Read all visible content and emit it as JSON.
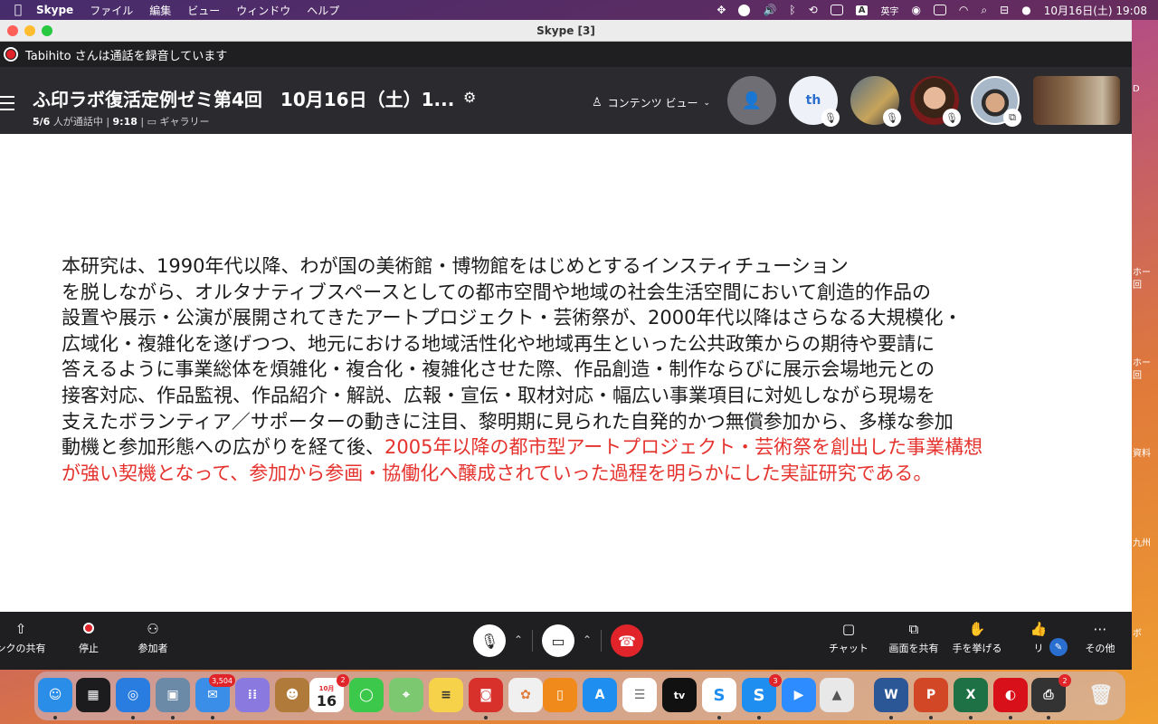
{
  "menubar": {
    "app": "Skype",
    "items": [
      "ファイル",
      "編集",
      "ビュー",
      "ウィンドウ",
      "ヘルプ"
    ],
    "ime": "A",
    "ime_label": "英字",
    "datetime": "10月16日(土)  19:08"
  },
  "window": {
    "title": "Skype [3]"
  },
  "recording_banner": "Tabihito さんは通話を録音しています",
  "call": {
    "title": "ふ印ラボ復活定例ゼミ第4回　10月16日（土）1...",
    "participants_count": "5/6",
    "participants_suffix": "人が通話中 |",
    "duration": "9:18",
    "duration_sep": "|",
    "view_mode": "ギャラリー",
    "content_view": "コンテンツ ビュー",
    "th_initials": "th"
  },
  "slide": {
    "lines": [
      "本研究は、1990年代以降、わが国の美術館・博物館をはじめとするインスティチューション",
      "を脱しながら、オルタナティブスペースとしての都市空間や地域の社会生活空間において創造的作品の",
      "設置や展示・公演が展開されてきたアートプロジェクト・芸術祭が、2000年代以降はさらなる大規模化・",
      "広域化・複雑化を遂げつつ、地元における地域活性化や地域再生といった公共政策からの期待や要請に",
      "答えるように事業総体を煩雑化・複合化・複雑化させた際、作品創造・制作ならびに展示会場地元との",
      "接客対応、作品監視、作品紹介・解説、広報・宣伝・取材対応・幅広い事業項目に対処しながら現場を",
      "支えたボランティア／サポーターの動きに注目、黎明期に見られた自発的かつ無償参加から、多様な参加"
    ],
    "line8_black": "動機と参加形態への広がりを経て後、",
    "line8_red": "2005年以降の都市型アートプロジェクト・芸術祭を創出した事業構想",
    "line9_red": "が強い契機となって、参加から参画・協働化へ醸成されていった過程を明らかにした実証研究である。",
    "highlight_color": "#e5322d"
  },
  "toolbar": {
    "share_link": "ンクの共有",
    "stop": "停止",
    "participants": "参加者",
    "chat": "チャット",
    "share_screen": "画面を共有",
    "raise_hand": "手を挙げる",
    "react": "リ",
    "more": "その他"
  },
  "desktop_labels": [
    "D",
    "ホー",
    "回",
    "ホー",
    "回",
    "資料",
    "九州",
    "ボ"
  ],
  "dock": {
    "mail_badge": "3,504",
    "calendar_month": "10月",
    "calendar_day": "16",
    "calendar_badge": "2",
    "skype_badge": "3",
    "printer_badge": "2"
  }
}
